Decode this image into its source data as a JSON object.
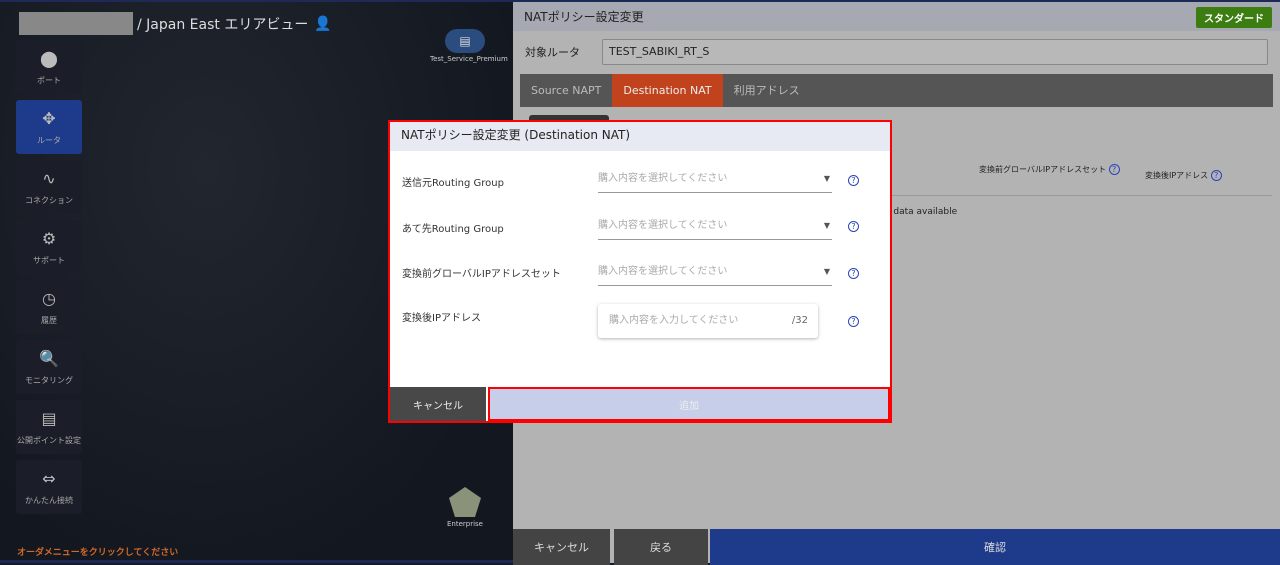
{
  "area": {
    "title": "/ Japan East エリアビュー",
    "user_icon": "user-headset-icon"
  },
  "sidebar": {
    "items": [
      {
        "label": "ポート",
        "icon": "port-icon",
        "glyph": "⬤"
      },
      {
        "label": "ルータ",
        "icon": "router-icon",
        "glyph": "✥"
      },
      {
        "label": "コネクション",
        "icon": "connection-icon",
        "glyph": "∿"
      },
      {
        "label": "サポート",
        "icon": "support-icon",
        "glyph": "⚙"
      },
      {
        "label": "履歴",
        "icon": "history-icon",
        "glyph": "◷"
      },
      {
        "label": "モニタリング",
        "icon": "monitoring-icon",
        "glyph": "🔍"
      },
      {
        "label": "公開ポイント設定",
        "icon": "public-point-icon",
        "glyph": "▤"
      },
      {
        "label": "かんたん接続",
        "icon": "easy-connect-icon",
        "glyph": "⇔"
      }
    ]
  },
  "footer_message": "オーダメニューをクリックしてください",
  "nodes": {
    "service": "Test_Service_Premium",
    "enterprise": "Enterprise"
  },
  "panel": {
    "title": "NATポリシー設定変更",
    "plan_badge": "スタンダード",
    "router_label": "対象ルータ",
    "router_value": "TEST_SABIKI_RT_S",
    "tabs": [
      {
        "label": "Source NAPT"
      },
      {
        "label": "Destination NAT",
        "active": true
      },
      {
        "label": "利用アドレス"
      }
    ],
    "table_headers": [
      "変換前グローバルIPアドレスセット",
      "変換後IPアドレス"
    ],
    "no_data": "o data available",
    "bottom": {
      "cancel": "キャンセル",
      "back": "戻る",
      "confirm": "確認"
    }
  },
  "modal": {
    "title": "NATポリシー設定変更 (Destination NAT)",
    "fields": [
      {
        "label": "送信元Routing Group",
        "placeholder": "購入内容を選択してください"
      },
      {
        "label": "あて先Routing Group",
        "placeholder": "購入内容を選択してください"
      },
      {
        "label": "変換前グローバルIPアドレスセット",
        "placeholder": "購入内容を選択してください"
      },
      {
        "label": "変換後IPアドレス",
        "placeholder": "購入内容を入力してください",
        "suffix": "/32"
      }
    ],
    "help": "?",
    "cancel": "キャンセル",
    "add": "追加"
  },
  "colors": {
    "accent_tab": "#c0431d",
    "confirm": "#1e3a8a",
    "badge": "#3c7d12",
    "highlight": "#ff0000"
  }
}
